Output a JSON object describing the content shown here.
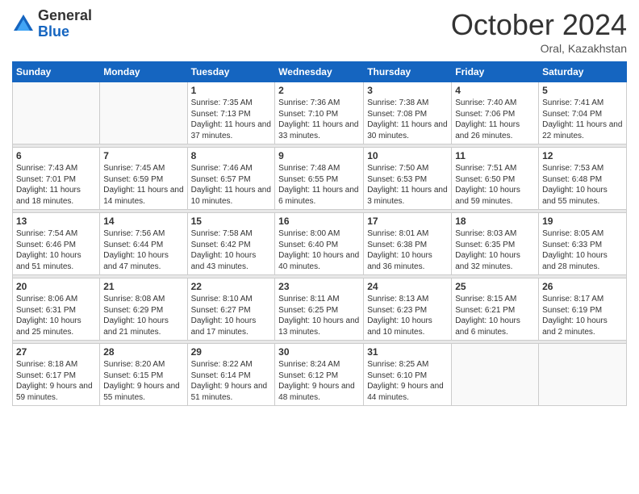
{
  "header": {
    "logo_general": "General",
    "logo_blue": "Blue",
    "month_title": "October 2024",
    "location": "Oral, Kazakhstan"
  },
  "days_of_week": [
    "Sunday",
    "Monday",
    "Tuesday",
    "Wednesday",
    "Thursday",
    "Friday",
    "Saturday"
  ],
  "weeks": [
    [
      {
        "day": "",
        "info": ""
      },
      {
        "day": "",
        "info": ""
      },
      {
        "day": "1",
        "info": "Sunrise: 7:35 AM\nSunset: 7:13 PM\nDaylight: 11 hours and 37 minutes."
      },
      {
        "day": "2",
        "info": "Sunrise: 7:36 AM\nSunset: 7:10 PM\nDaylight: 11 hours and 33 minutes."
      },
      {
        "day": "3",
        "info": "Sunrise: 7:38 AM\nSunset: 7:08 PM\nDaylight: 11 hours and 30 minutes."
      },
      {
        "day": "4",
        "info": "Sunrise: 7:40 AM\nSunset: 7:06 PM\nDaylight: 11 hours and 26 minutes."
      },
      {
        "day": "5",
        "info": "Sunrise: 7:41 AM\nSunset: 7:04 PM\nDaylight: 11 hours and 22 minutes."
      }
    ],
    [
      {
        "day": "6",
        "info": "Sunrise: 7:43 AM\nSunset: 7:01 PM\nDaylight: 11 hours and 18 minutes."
      },
      {
        "day": "7",
        "info": "Sunrise: 7:45 AM\nSunset: 6:59 PM\nDaylight: 11 hours and 14 minutes."
      },
      {
        "day": "8",
        "info": "Sunrise: 7:46 AM\nSunset: 6:57 PM\nDaylight: 11 hours and 10 minutes."
      },
      {
        "day": "9",
        "info": "Sunrise: 7:48 AM\nSunset: 6:55 PM\nDaylight: 11 hours and 6 minutes."
      },
      {
        "day": "10",
        "info": "Sunrise: 7:50 AM\nSunset: 6:53 PM\nDaylight: 11 hours and 3 minutes."
      },
      {
        "day": "11",
        "info": "Sunrise: 7:51 AM\nSunset: 6:50 PM\nDaylight: 10 hours and 59 minutes."
      },
      {
        "day": "12",
        "info": "Sunrise: 7:53 AM\nSunset: 6:48 PM\nDaylight: 10 hours and 55 minutes."
      }
    ],
    [
      {
        "day": "13",
        "info": "Sunrise: 7:54 AM\nSunset: 6:46 PM\nDaylight: 10 hours and 51 minutes."
      },
      {
        "day": "14",
        "info": "Sunrise: 7:56 AM\nSunset: 6:44 PM\nDaylight: 10 hours and 47 minutes."
      },
      {
        "day": "15",
        "info": "Sunrise: 7:58 AM\nSunset: 6:42 PM\nDaylight: 10 hours and 43 minutes."
      },
      {
        "day": "16",
        "info": "Sunrise: 8:00 AM\nSunset: 6:40 PM\nDaylight: 10 hours and 40 minutes."
      },
      {
        "day": "17",
        "info": "Sunrise: 8:01 AM\nSunset: 6:38 PM\nDaylight: 10 hours and 36 minutes."
      },
      {
        "day": "18",
        "info": "Sunrise: 8:03 AM\nSunset: 6:35 PM\nDaylight: 10 hours and 32 minutes."
      },
      {
        "day": "19",
        "info": "Sunrise: 8:05 AM\nSunset: 6:33 PM\nDaylight: 10 hours and 28 minutes."
      }
    ],
    [
      {
        "day": "20",
        "info": "Sunrise: 8:06 AM\nSunset: 6:31 PM\nDaylight: 10 hours and 25 minutes."
      },
      {
        "day": "21",
        "info": "Sunrise: 8:08 AM\nSunset: 6:29 PM\nDaylight: 10 hours and 21 minutes."
      },
      {
        "day": "22",
        "info": "Sunrise: 8:10 AM\nSunset: 6:27 PM\nDaylight: 10 hours and 17 minutes."
      },
      {
        "day": "23",
        "info": "Sunrise: 8:11 AM\nSunset: 6:25 PM\nDaylight: 10 hours and 13 minutes."
      },
      {
        "day": "24",
        "info": "Sunrise: 8:13 AM\nSunset: 6:23 PM\nDaylight: 10 hours and 10 minutes."
      },
      {
        "day": "25",
        "info": "Sunrise: 8:15 AM\nSunset: 6:21 PM\nDaylight: 10 hours and 6 minutes."
      },
      {
        "day": "26",
        "info": "Sunrise: 8:17 AM\nSunset: 6:19 PM\nDaylight: 10 hours and 2 minutes."
      }
    ],
    [
      {
        "day": "27",
        "info": "Sunrise: 8:18 AM\nSunset: 6:17 PM\nDaylight: 9 hours and 59 minutes."
      },
      {
        "day": "28",
        "info": "Sunrise: 8:20 AM\nSunset: 6:15 PM\nDaylight: 9 hours and 55 minutes."
      },
      {
        "day": "29",
        "info": "Sunrise: 8:22 AM\nSunset: 6:14 PM\nDaylight: 9 hours and 51 minutes."
      },
      {
        "day": "30",
        "info": "Sunrise: 8:24 AM\nSunset: 6:12 PM\nDaylight: 9 hours and 48 minutes."
      },
      {
        "day": "31",
        "info": "Sunrise: 8:25 AM\nSunset: 6:10 PM\nDaylight: 9 hours and 44 minutes."
      },
      {
        "day": "",
        "info": ""
      },
      {
        "day": "",
        "info": ""
      }
    ]
  ]
}
